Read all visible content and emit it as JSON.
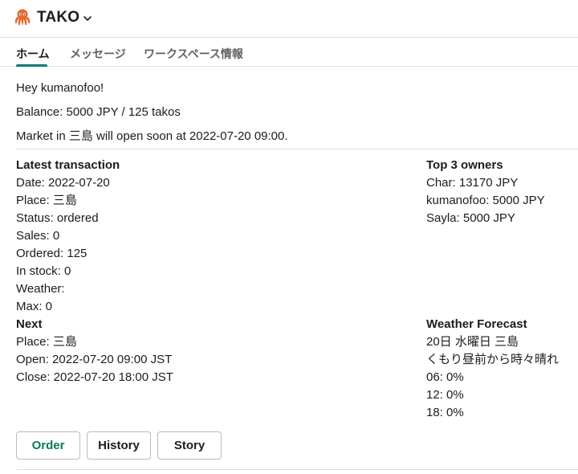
{
  "app": {
    "title": "TAKO"
  },
  "tabs": [
    {
      "label": "ホーム"
    },
    {
      "label": "メッセージ"
    },
    {
      "label": "ワークスペース情報"
    }
  ],
  "greeting": "Hey kumanofoo!",
  "balance": "Balance: 5000 JPY / 125 takos",
  "market_status": "Market in 三島 will open soon at 2022-07-20 09:00.",
  "latest_transaction": {
    "heading": "Latest transaction",
    "date": "Date: 2022-07-20",
    "place": "Place: 三島",
    "status": "Status: ordered",
    "sales": "Sales: 0",
    "ordered": "Ordered: 125",
    "in_stock": "In stock: 0",
    "weather": "Weather:",
    "max": "Max: 0"
  },
  "top_owners": {
    "heading": "Top 3 owners",
    "items": [
      "Char: 13170 JPY",
      "kumanofoo: 5000 JPY",
      "Sayla: 5000 JPY"
    ]
  },
  "next": {
    "heading": "Next",
    "place": "Place: 三島",
    "open": "Open: 2022-07-20 09:00 JST",
    "close": "Close: 2022-07-20 18:00 JST"
  },
  "weather_forecast": {
    "heading": "Weather Forecast",
    "day": "20日 水曜日 三島",
    "summary": "くもり昼前から時々晴れ",
    "rain": [
      "06: 0%",
      "12: 0%",
      "18: 0%"
    ]
  },
  "actions": {
    "order": "Order",
    "history": "History",
    "story": "Story"
  },
  "colors": {
    "accent": "#0b7a75",
    "octopus": "#e8662c"
  },
  "icons": {
    "logo": "octopus-icon",
    "dropdown": "chevron-down-icon"
  }
}
